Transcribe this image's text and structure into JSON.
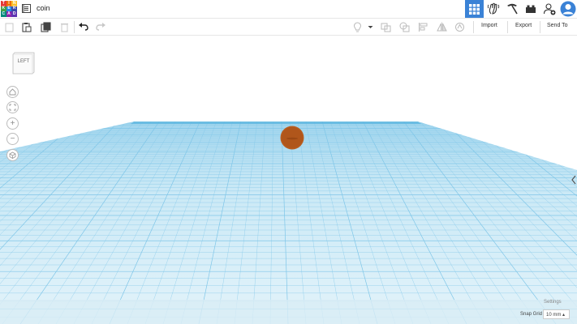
{
  "app": {
    "logo_letters": [
      "T",
      "I",
      "N",
      "K",
      "E",
      "R",
      "C",
      "A",
      "D"
    ],
    "logo_colors": [
      "#e53935",
      "#ef6c00",
      "#fbc02d",
      "#43a047",
      "#1e88e5",
      "#3949ab",
      "#00897b",
      "#8e24aa",
      "#5e35b1"
    ],
    "design_title": "coin"
  },
  "topbar": {
    "icons": [
      "grid-view-icon",
      "hand-wave-icon",
      "pickaxe-icon",
      "brick-icon",
      "add-user-icon",
      "avatar-icon"
    ],
    "active_index": 0,
    "accent": "#3a82d6"
  },
  "toolbar": {
    "import_label": "Import",
    "export_label": "Export",
    "sendto_label": "Send To"
  },
  "viewcube": {
    "label": "LEFT"
  },
  "workplane": {
    "grid_color": "#7fc6e8",
    "plane_color": "#d8eef8"
  },
  "object": {
    "name": "coin",
    "color": "#b85c1e"
  },
  "footer": {
    "settings_label": "Settings",
    "snap_grid_label": "Snap Grid",
    "snap_value": "10 mm",
    "snap_arrow": "▴"
  }
}
